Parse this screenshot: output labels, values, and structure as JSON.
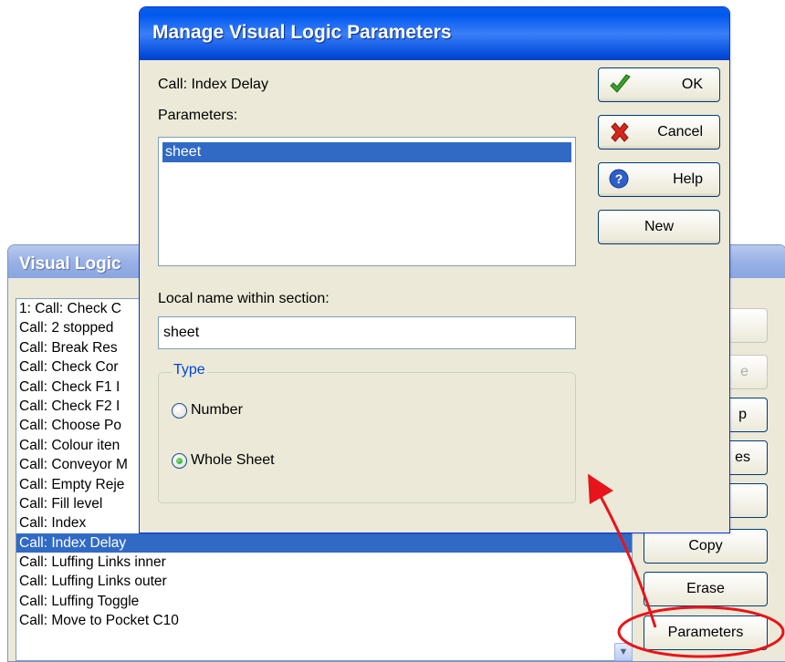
{
  "back_window": {
    "title": "Visual Logic",
    "procedures": [
      "1: Call: Check C",
      "Call: 2 stopped",
      "Call: Break Res",
      "Call: Check Cor",
      "Call: Check F1 I",
      "Call: Check F2 I",
      "Call: Choose Po",
      "Call: Colour iten",
      "Call: Conveyor M",
      "Call: Empty Reje",
      "Call: Fill level",
      "Call: Index",
      "Call: Index Delay",
      "Call: Luffing Links inner",
      "Call: Luffing Links outer",
      "Call: Luffing Toggle",
      "Call: Move to Pocket C10"
    ],
    "selected_index": 12,
    "side_buttons": [
      {
        "label": "",
        "enabled": false
      },
      {
        "label": "e",
        "enabled": false
      },
      {
        "label": "p",
        "enabled": true
      },
      {
        "label": "es",
        "enabled": true
      },
      {
        "label": "",
        "enabled": true
      },
      {
        "label": "Copy",
        "enabled": true
      },
      {
        "label": "Erase",
        "enabled": true
      },
      {
        "label": "Parameters",
        "enabled": true
      }
    ]
  },
  "dialog": {
    "title": "Manage Visual Logic Parameters",
    "call_label": "Call: Index Delay",
    "parameters_label": "Parameters:",
    "parameters": [
      "sheet"
    ],
    "local_name_label": "Local name within section:",
    "local_name_value": "sheet",
    "type_group_label": "Type",
    "type_options": [
      "Number",
      "Whole Sheet"
    ],
    "type_selected": "Whole Sheet",
    "buttons": {
      "ok": "OK",
      "cancel": "Cancel",
      "help": "Help",
      "new": "New"
    }
  },
  "colors": {
    "title_blue": "#0054e3",
    "selection": "#316ac5",
    "annotation_red": "#e8141b",
    "dialog_face": "#ece9d8"
  }
}
